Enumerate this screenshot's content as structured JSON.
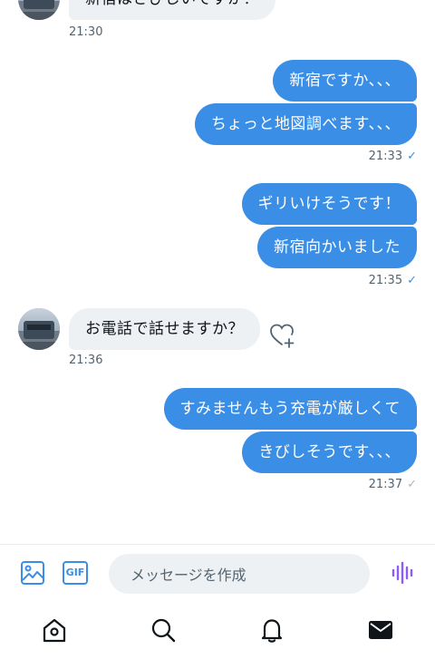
{
  "messages": {
    "m1": {
      "text": "新宿はさびしいですか？",
      "time": "21:30"
    },
    "m2": {
      "text": "新宿ですか、、、"
    },
    "m3": {
      "text": "ちょっと地図調べます、、、",
      "time": "21:33",
      "status": "✓"
    },
    "m4": {
      "text": "ギリいけそうです！"
    },
    "m5": {
      "text": "新宿向かいました",
      "time": "21:35",
      "status": "✓"
    },
    "m6": {
      "text": "お電話で話せますか？",
      "time": "21:36"
    },
    "m7": {
      "text": "すみませんもう充電が厳しくて"
    },
    "m8": {
      "text": "きびしそうです、、、",
      "time": "21:37",
      "status": "✓"
    }
  },
  "composer": {
    "gif_label": "GIF",
    "placeholder": "メッセージを作成",
    "accent": "#8b5cf6"
  },
  "colors": {
    "outgoing_bubble": "#3a8ee6",
    "incoming_bubble": "#eef1f4",
    "timestamp": "#536471"
  },
  "tabs": [
    "home-icon",
    "search-icon",
    "bell-icon",
    "mail-icon"
  ]
}
